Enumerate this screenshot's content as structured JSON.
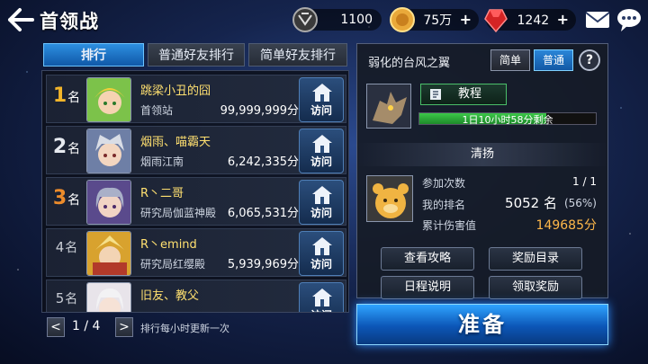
{
  "header": {
    "title": "首领战",
    "resources": [
      {
        "icon": "guild-emblem-icon",
        "value": "1100"
      },
      {
        "icon": "gold-coin-icon",
        "value": "75万"
      },
      {
        "icon": "ruby-gem-icon",
        "value": "1242"
      }
    ],
    "plus": "+"
  },
  "tabs": [
    {
      "label": "排行",
      "active": true
    },
    {
      "label": "普通好友排行",
      "active": false
    },
    {
      "label": "简单好友排行",
      "active": false
    }
  ],
  "ranking": {
    "unit": "名",
    "visit_label": "访问",
    "rows": [
      {
        "rank": "1",
        "name": "跳梁小丑的囧",
        "guild": "首领站",
        "score": "99,999,999分",
        "rank_color": "#f3b52a"
      },
      {
        "rank": "2",
        "name": "烟雨、喵霸天",
        "guild": "烟雨江南",
        "score": "6,242,335分",
        "rank_color": "#e6e9ef"
      },
      {
        "rank": "3",
        "name": "R丶二哥",
        "guild": "研究局伽蓝神殿",
        "score": "6,065,531分",
        "rank_color": "#ec8b2b"
      },
      {
        "rank": "4",
        "name": "R丶emind",
        "guild": "研究局红缨殿",
        "score": "5,939,969分",
        "rank_color": "#c8ccd4"
      },
      {
        "rank": "5",
        "name": "旧友、教父",
        "guild": "",
        "score": "",
        "rank_color": "#c8ccd4"
      }
    ],
    "page": "1 / 4",
    "prev": "<",
    "next": ">",
    "note": "排行每小时更新一次"
  },
  "boss": {
    "name": "弱化的台风之翼",
    "difficulty": {
      "easy": "简单",
      "normal": "普通",
      "selected": "普通"
    },
    "help": "?",
    "tutorial": "教程",
    "timer": "1日10小时58分剩余",
    "timer_progress": 0.72,
    "clear_title": "清扬",
    "stats": {
      "participation_label": "参加次数",
      "participation_value": "1 / 1",
      "my_rank_label": "我的排名",
      "my_rank_value": "5052 名",
      "my_rank_pct": "(56%)",
      "damage_label": "累计伤害值",
      "damage_value": "149685分"
    },
    "buttons": {
      "guide": "查看攻略",
      "reward_list": "奖励目录",
      "schedule": "日程说明",
      "claim": "领取奖励"
    },
    "ready": "准备"
  },
  "colors": {
    "accent": "#1a7ee0",
    "gold": "#f3b52a",
    "damage": "#ffb84a"
  }
}
